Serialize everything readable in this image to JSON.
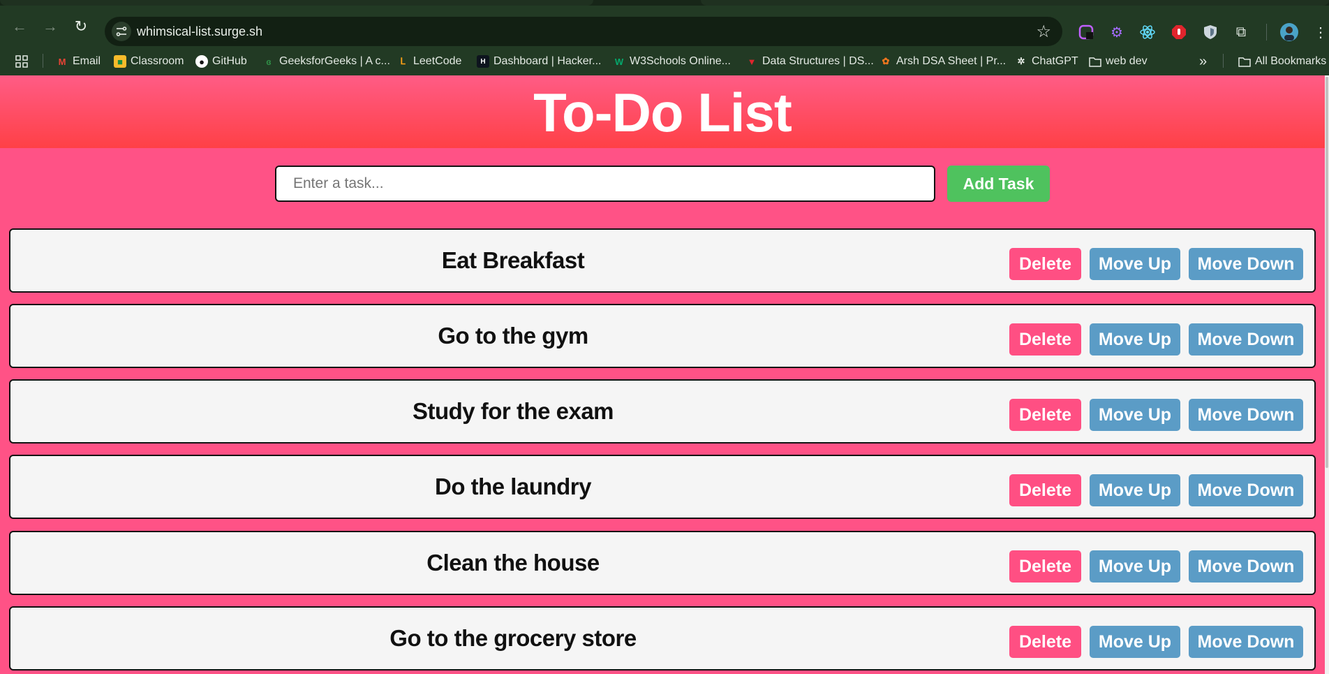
{
  "browser": {
    "url": "whimsical-list.surge.sh",
    "bookmarks": [
      {
        "label": "Email",
        "icon": "gmail-icon"
      },
      {
        "label": "Classroom",
        "icon": "classroom-icon"
      },
      {
        "label": "GitHub",
        "icon": "github-icon"
      },
      {
        "label": "GeeksforGeeks | A c...",
        "icon": "geeksforgeeks-icon"
      },
      {
        "label": "LeetCode",
        "icon": "leetcode-icon"
      },
      {
        "label": "Dashboard | Hacker...",
        "icon": "hackerrank-icon"
      },
      {
        "label": "W3Schools Online...",
        "icon": "w3schools-icon"
      },
      {
        "label": "Data Structures | DS...",
        "icon": "data-structures-icon"
      },
      {
        "label": "Arsh DSA Sheet | Pr...",
        "icon": "arsh-dsa-icon"
      },
      {
        "label": "ChatGPT",
        "icon": "chatgpt-icon"
      },
      {
        "label": "web dev",
        "icon": "folder-icon"
      }
    ],
    "all_bookmarks": "All Bookmarks"
  },
  "app": {
    "title": "To-Do List",
    "input_placeholder": "Enter a task...",
    "add_button": "Add Task",
    "buttons": {
      "delete": "Delete",
      "move_up": "Move Up",
      "move_down": "Move Down"
    },
    "tasks": [
      "Eat Breakfast",
      "Go to the gym",
      "Study for the exam",
      "Do the laundry",
      "Clean the house",
      "Go to the grocery store"
    ]
  },
  "colors": {
    "background": "#ff5286",
    "header_gradient_top": "#ff5c86",
    "header_gradient_bottom": "#ff4046",
    "add_button": "#4fc25e",
    "delete_button": "#ff4f83",
    "move_button": "#5b9cc6"
  }
}
